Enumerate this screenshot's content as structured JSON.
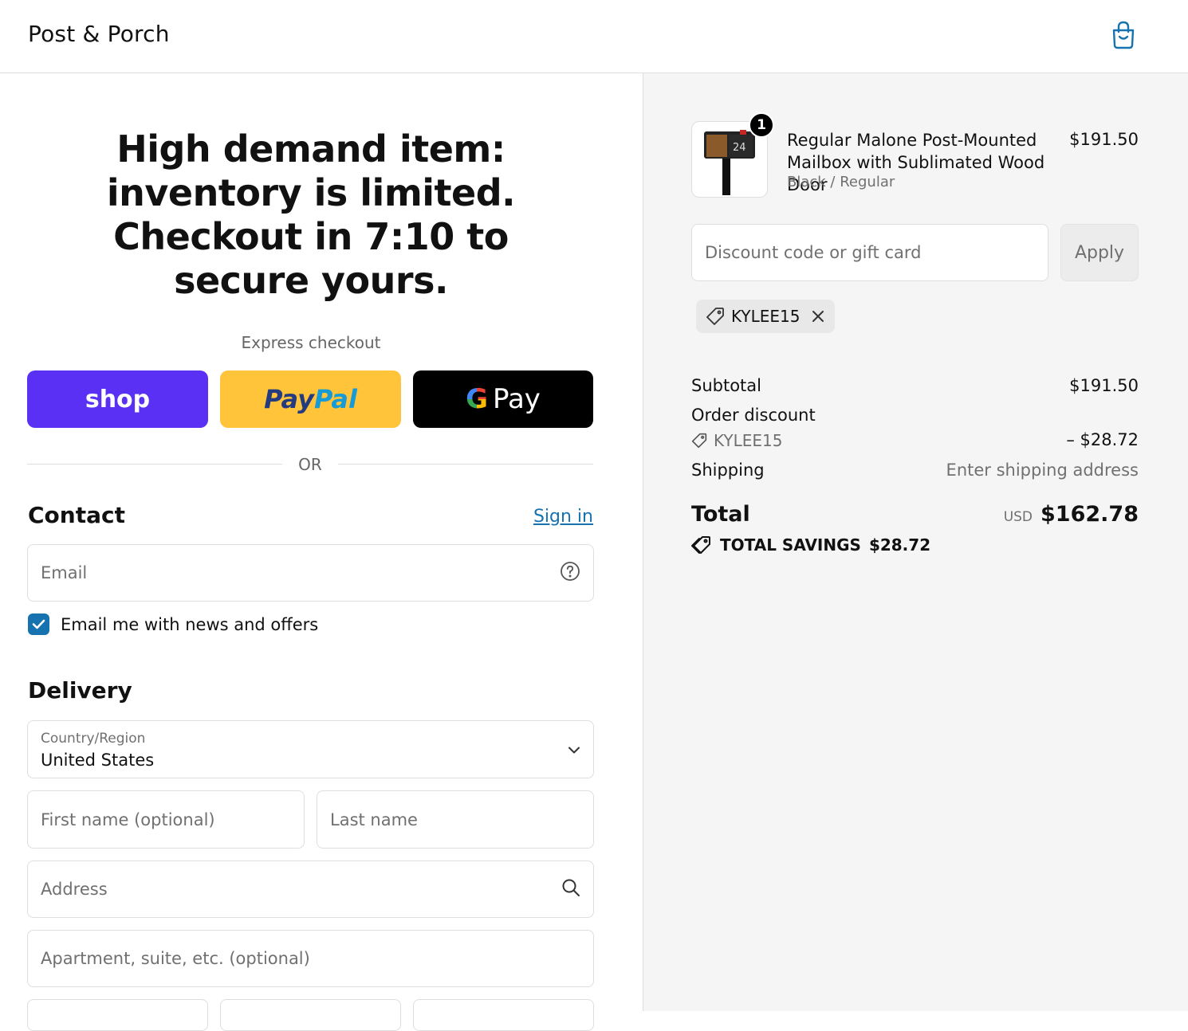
{
  "header": {
    "brand": "Post & Porch"
  },
  "banner": {
    "text": "High demand item: inventory is limited. Checkout in 7:10 to secure yours."
  },
  "express": {
    "label": "Express checkout",
    "shop_label": "shop",
    "paypal_part1": "Pay",
    "paypal_part2": "Pal",
    "gpay_g": "G",
    "gpay_label": "Pay"
  },
  "divider": {
    "or_label": "OR"
  },
  "contact": {
    "title": "Contact",
    "sign_in": "Sign in",
    "email_placeholder": "Email",
    "news_opt_in": "Email me with news and offers",
    "news_opt_in_checked": true
  },
  "delivery": {
    "title": "Delivery",
    "country_label": "Country/Region",
    "country_value": "United States",
    "first_name_placeholder": "First name (optional)",
    "last_name_placeholder": "Last name",
    "address_placeholder": "Address",
    "apartment_placeholder": "Apartment, suite, etc. (optional)"
  },
  "order": {
    "product": {
      "title": "Regular Malone Post-Mounted Mailbox with Sublimated Wood Door",
      "variant": "Black / Regular",
      "price": "$191.50",
      "quantity": "1",
      "thumb_number": "24"
    },
    "discount_placeholder": "Discount code or gift card",
    "apply_label": "Apply",
    "applied_code": "KYLEE15",
    "subtotal_label": "Subtotal",
    "subtotal_value": "$191.50",
    "order_discount_label": "Order discount",
    "order_discount_code": "KYLEE15",
    "order_discount_value": "– $28.72",
    "shipping_label": "Shipping",
    "shipping_value": "Enter shipping address",
    "total_label": "Total",
    "total_currency": "USD",
    "total_value": "$162.78",
    "savings_label": "TOTAL SAVINGS",
    "savings_value": "$28.72"
  },
  "colors": {
    "shop_purple": "#5a31f4",
    "paypal_yellow": "#ffc439",
    "link_blue": "#1773b0",
    "checkbox_blue": "#1773b0"
  },
  "icons": {
    "cart": "shopping-bag-icon",
    "help": "help-circle-icon",
    "search": "search-icon",
    "chevron": "chevron-down-icon",
    "tag": "tag-icon",
    "close": "close-icon",
    "check": "check-icon"
  }
}
